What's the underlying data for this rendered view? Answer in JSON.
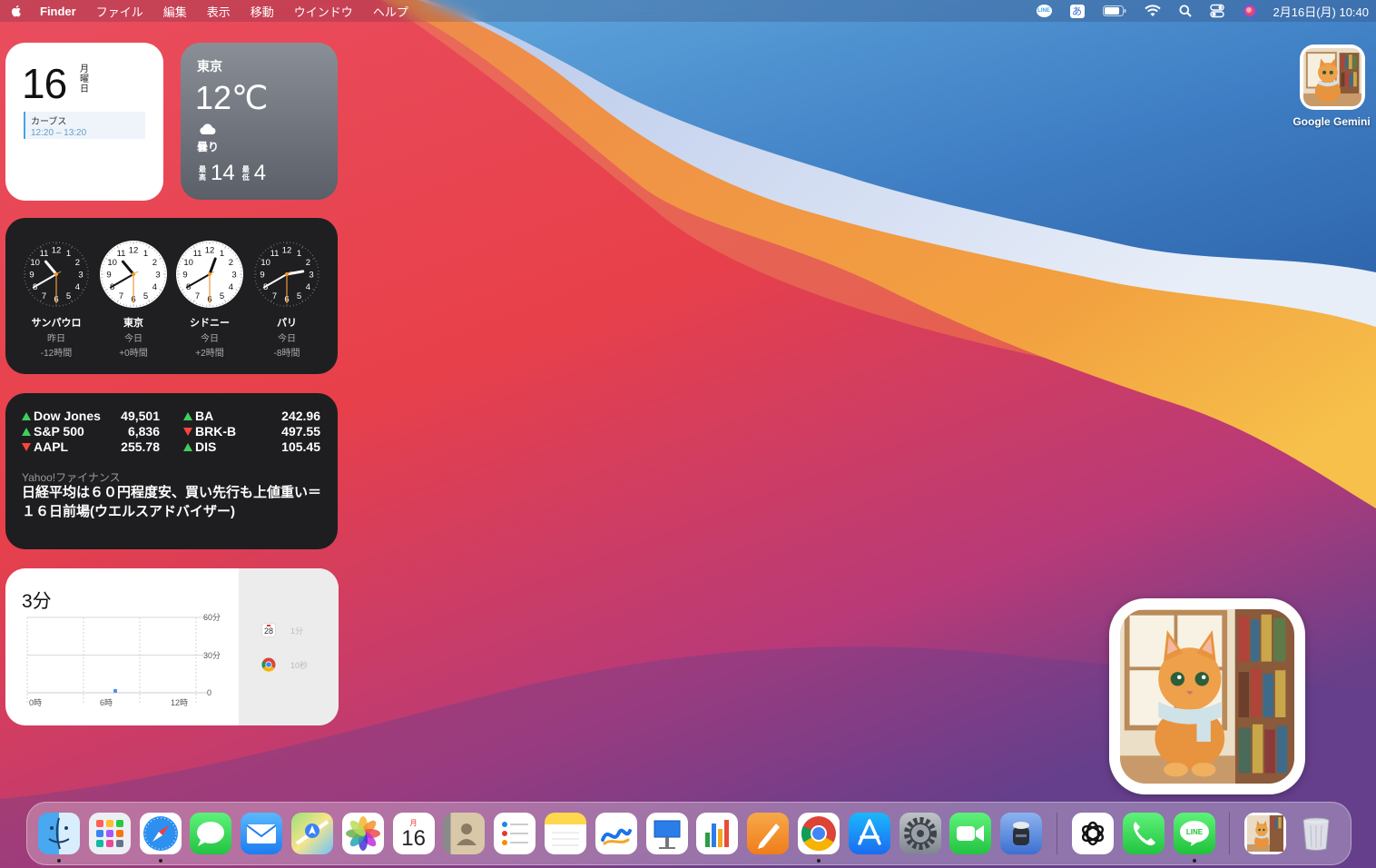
{
  "menubar": {
    "app_name": "Finder",
    "menus": [
      "ファイル",
      "編集",
      "表示",
      "移動",
      "ウインドウ",
      "ヘルプ"
    ],
    "status_icons": [
      "line-icon",
      "input-method-icon",
      "battery-icon",
      "wifi-icon",
      "spotlight-search-icon",
      "control-center-icon",
      "siri-icon"
    ],
    "ime_label": "あ",
    "line_label": "LINE",
    "datetime": "2月16日(月) 10:40"
  },
  "calendar_widget": {
    "day": "16",
    "weekday": "月曜日",
    "event_title": "カーブス",
    "event_time": "12:20 – 13:20"
  },
  "weather_widget": {
    "city": "東京",
    "temp": "12℃",
    "condition": "曇り",
    "high_tag": "最高",
    "high": "14",
    "low_tag": "最低",
    "low": "4"
  },
  "clock_widget": {
    "clocks": [
      {
        "city": "サンパウロ",
        "day": "昨日",
        "offset": "-12時間",
        "hour": 22,
        "minute": 40,
        "dark": true
      },
      {
        "city": "東京",
        "day": "今日",
        "offset": "+0時間",
        "hour": 10,
        "minute": 40,
        "dark": false
      },
      {
        "city": "シドニー",
        "day": "今日",
        "offset": "+2時間",
        "hour": 12,
        "minute": 40,
        "dark": false
      },
      {
        "city": "パリ",
        "day": "今日",
        "offset": "-8時間",
        "hour": 2,
        "minute": 40,
        "dark": true
      }
    ]
  },
  "stocks_widget": {
    "left": [
      {
        "symbol": "Dow Jones",
        "value": "49,501",
        "trend": "up"
      },
      {
        "symbol": "S&P 500",
        "value": "6,836",
        "trend": "up"
      },
      {
        "symbol": "AAPL",
        "value": "255.78",
        "trend": "down"
      }
    ],
    "right": [
      {
        "symbol": "BA",
        "value": "242.96",
        "trend": "up"
      },
      {
        "symbol": "BRK-B",
        "value": "497.55",
        "trend": "down"
      },
      {
        "symbol": "DIS",
        "value": "105.45",
        "trend": "up"
      }
    ],
    "source": "Yahoo!ファイナンス",
    "headline": "日経平均は６０円程度安、買い先行も上値重い＝１６日前場(ウエルスアドバイザー)"
  },
  "screentime_widget": {
    "total": "3分",
    "chart_data": {
      "type": "bar",
      "x_ticks": [
        "0時",
        "6時",
        "12時"
      ],
      "y_ticks": [
        "60分",
        "30分",
        "0"
      ],
      "ylim": [
        0,
        60
      ],
      "values": [
        {
          "hour": 9,
          "minutes": 3
        }
      ]
    },
    "apps": [
      {
        "icon": "calendar-icon",
        "cal_day": "28",
        "time": "1分"
      },
      {
        "icon": "chrome-icon",
        "time": "10秒"
      }
    ]
  },
  "desktop": {
    "icon_label": "Google Gemini"
  },
  "dock": {
    "calendar_month": "月",
    "calendar_day": "16",
    "items": [
      {
        "name": "finder",
        "running": true
      },
      {
        "name": "launchpad",
        "running": false
      },
      {
        "name": "safari",
        "running": true
      },
      {
        "name": "messages",
        "running": false
      },
      {
        "name": "mail",
        "running": false
      },
      {
        "name": "maps",
        "running": false
      },
      {
        "name": "photos",
        "running": false
      },
      {
        "name": "calendar",
        "running": false
      },
      {
        "name": "contacts",
        "running": false
      },
      {
        "name": "reminders",
        "running": false
      },
      {
        "name": "notes",
        "running": false
      },
      {
        "name": "freeform",
        "running": false
      },
      {
        "name": "keynote",
        "running": false
      },
      {
        "name": "numbers",
        "running": false
      },
      {
        "name": "pages",
        "running": false
      },
      {
        "name": "chrome",
        "running": true
      },
      {
        "name": "app-store",
        "running": false
      },
      {
        "name": "system-settings",
        "running": false
      },
      {
        "name": "facetime",
        "running": false
      },
      {
        "name": "automator",
        "running": false
      },
      {
        "name": "chatgpt",
        "running": false
      },
      {
        "name": "phone",
        "running": false
      },
      {
        "name": "line",
        "running": true
      },
      {
        "name": "gemini-image",
        "running": false
      },
      {
        "name": "trash",
        "running": false
      }
    ]
  }
}
